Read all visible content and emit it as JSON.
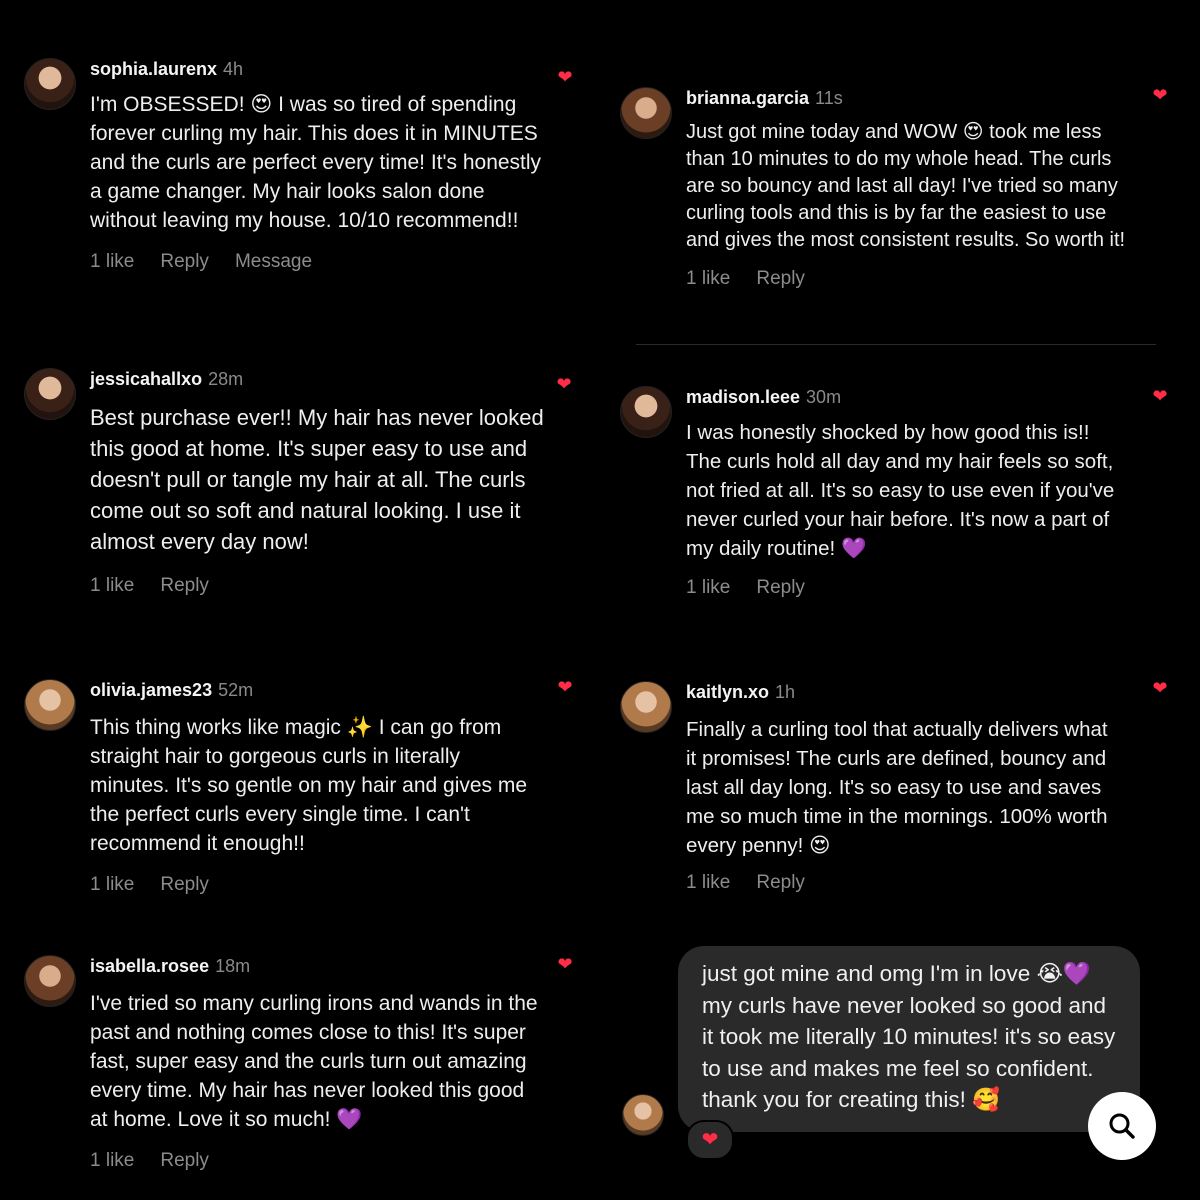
{
  "comments": [
    {
      "user": "sophia.laurenx",
      "time": "4h",
      "lines": [
        "I'm OBSESSED! 😍 I was so tired of spending",
        "forever curling my hair. This does it in MINUTES",
        "and the curls are perfect every time! It's honestly",
        "a game changer. My hair looks salon done",
        "without leaving my house. 10/10 recommend!!"
      ],
      "likes": "1 like",
      "reply": "Reply",
      "message": "Message"
    },
    {
      "user": "brianna.garcia",
      "time": "11s",
      "lines": [
        "Just got mine today and WOW 😍 took me less",
        "than 10 minutes to do my whole head. The curls",
        "are so bouncy and last all day! I've tried so many",
        "curling tools and this is by far the easiest to use",
        "and gives the most consistent results. So worth it!"
      ],
      "likes": "1 like",
      "reply": "Reply"
    },
    {
      "user": "jessicahallxo",
      "time": "28m",
      "lines": [
        "Best purchase ever!! My hair has never looked",
        "this good at home. It's super easy to use and",
        "doesn't pull or tangle my hair at all. The curls",
        "come out so soft and natural looking. I use it",
        "almost every day now!"
      ],
      "likes": "1 like",
      "reply": "Reply"
    },
    {
      "user": "madison.leee",
      "time": "30m",
      "lines": [
        "I was honestly shocked by how good this is!!",
        "The curls hold all day and my hair feels so soft,",
        "not fried at all. It's so easy to use even if you've",
        "never curled your hair before. It's now a part of",
        "my daily routine! 💜"
      ],
      "likes": "1 like",
      "reply": "Reply"
    },
    {
      "user": "olivia.james23",
      "time": "52m",
      "lines": [
        "This thing works like magic ✨ I can go from",
        "straight hair to gorgeous curls in literally",
        "minutes. It's so gentle on my hair and gives me",
        "the perfect curls every single time. I can't",
        "recommend it enough!!"
      ],
      "likes": "1 like",
      "reply": "Reply"
    },
    {
      "user": "kaitlyn.xo",
      "time": "1h",
      "lines": [
        "Finally a curling tool that actually delivers what",
        "it promises! The curls are defined, bouncy and",
        "last all day long. It's so easy to use and saves",
        "me so much time in the mornings. 100% worth",
        "every penny! 😍"
      ],
      "likes": "1 like",
      "reply": "Reply"
    },
    {
      "user": "isabella.rosee",
      "time": "18m",
      "lines": [
        "I've tried so many curling irons and wands in the",
        "past and nothing comes close to this! It's super",
        "fast, super easy and the curls turn out amazing",
        "every time. My hair has never looked this good",
        "at home. Love it so much! 💜"
      ],
      "likes": "1 like",
      "reply": "Reply"
    }
  ],
  "dm": {
    "lines": [
      "just got mine and omg I'm in love 😭💜",
      "my curls have never looked so good and",
      "it took me literally 10 minutes! it's so easy",
      "to use and makes me feel so confident.",
      "thank you for creating this! 🥰"
    ],
    "reaction": "❤"
  },
  "icons": {
    "like": "heart-icon",
    "search": "search-icon"
  },
  "colors": {
    "background": "#000000",
    "heart": "#ff2d45",
    "muted": "#8c8c8c",
    "bubble": "#2a2a2a"
  }
}
